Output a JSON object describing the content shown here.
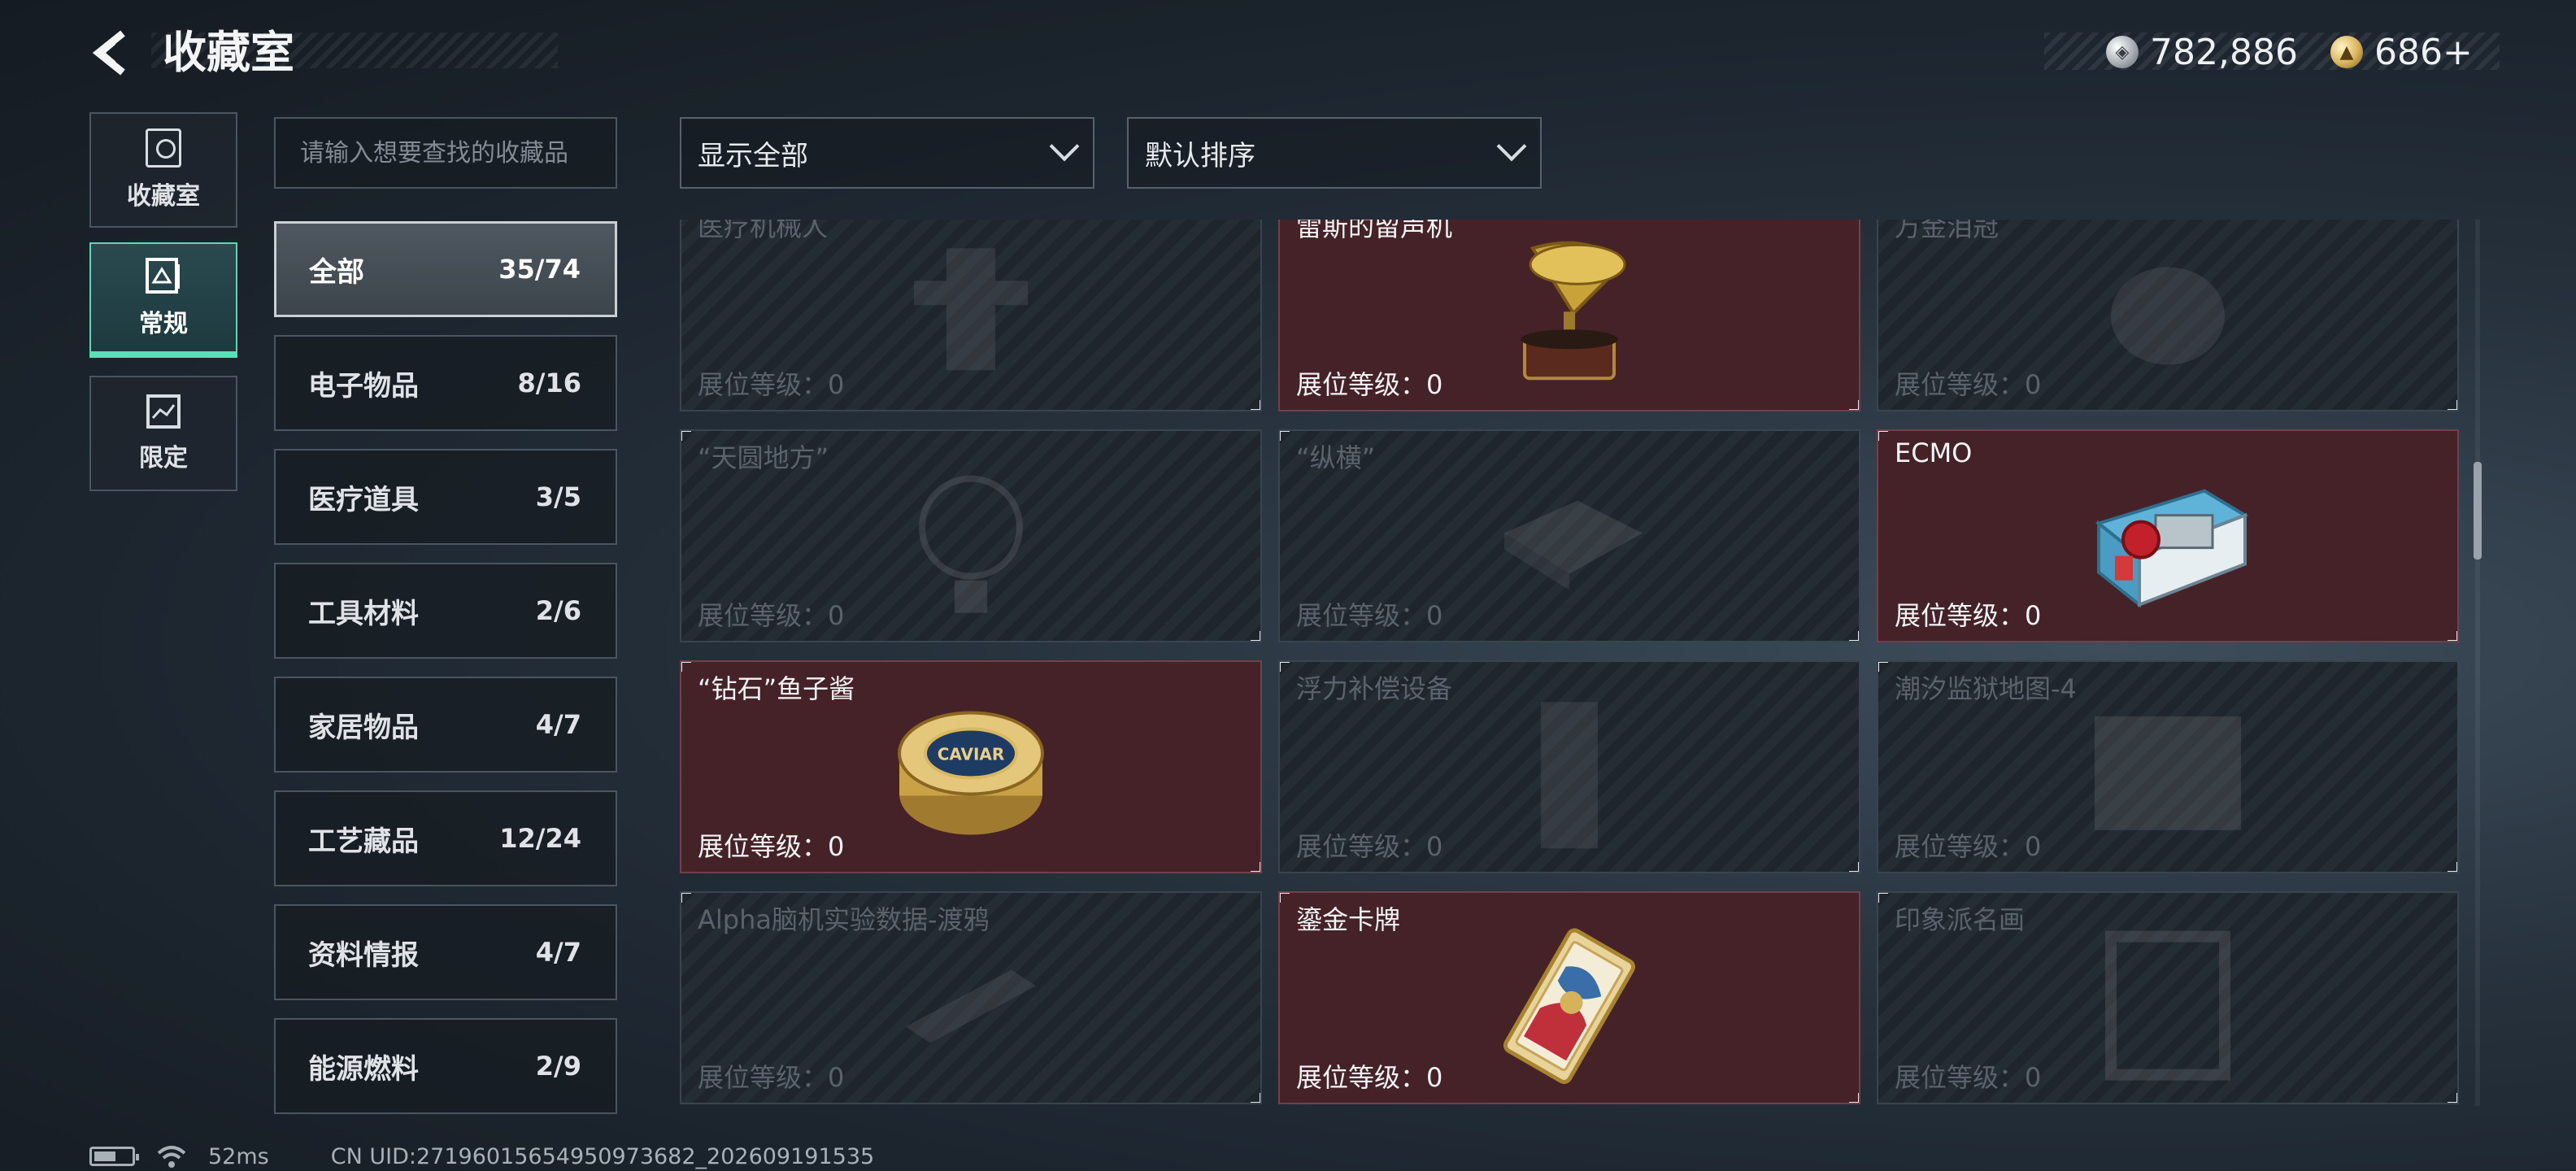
{
  "header": {
    "title": "收藏室",
    "back_icon": "back-arrow-icon"
  },
  "currency": {
    "silver": "782,886",
    "gold": "686+"
  },
  "rail": [
    {
      "label": "收藏室",
      "icon": "trophy-icon",
      "active": false
    },
    {
      "label": "常规",
      "icon": "gallery-icon",
      "active": true
    },
    {
      "label": "限定",
      "icon": "limited-icon",
      "active": false
    }
  ],
  "search": {
    "placeholder": "请输入想要查找的收藏品"
  },
  "filters": {
    "display": "显示全部",
    "sort": "默认排序"
  },
  "categories": [
    {
      "name": "全部",
      "count": "35/74",
      "active": true
    },
    {
      "name": "电子物品",
      "count": "8/16"
    },
    {
      "name": "医疗道具",
      "count": "3/5"
    },
    {
      "name": "工具材料",
      "count": "2/6"
    },
    {
      "name": "家居物品",
      "count": "4/7"
    },
    {
      "name": "工艺藏品",
      "count": "12/24"
    },
    {
      "name": "资料情报",
      "count": "4/7"
    },
    {
      "name": "能源燃料",
      "count": "2/9"
    }
  ],
  "cards": [
    {
      "name": "医疗机械人",
      "level": "展位等级：0",
      "owned": false
    },
    {
      "name": "雷斯的留声机",
      "level": "展位等级：0",
      "owned": true
    },
    {
      "name": "万金泪冠",
      "level": "展位等级：0",
      "owned": false
    },
    {
      "name": "“天圆地方”",
      "level": "展位等级：0",
      "owned": false
    },
    {
      "name": "“纵横”",
      "level": "展位等级：0",
      "owned": false
    },
    {
      "name": "ECMO",
      "level": "展位等级：0",
      "owned": true
    },
    {
      "name": "“钻石”鱼子酱",
      "level": "展位等级：0",
      "owned": true
    },
    {
      "name": "浮力补偿设备",
      "level": "展位等级：0",
      "owned": false
    },
    {
      "name": "潮汐监狱地图-4",
      "level": "展位等级：0",
      "owned": false
    },
    {
      "name": "Alpha脑机实验数据-渡鸦",
      "level": "展位等级：0",
      "owned": false
    },
    {
      "name": "鎏金卡牌",
      "level": "展位等级：0",
      "owned": true
    },
    {
      "name": "印象派名画",
      "level": "展位等级：0",
      "owned": false
    }
  ],
  "caviar_label": "CAVIAR",
  "footer": {
    "ping": "52ms",
    "uid": "CN UID:27196015654950973682_202609191535"
  }
}
